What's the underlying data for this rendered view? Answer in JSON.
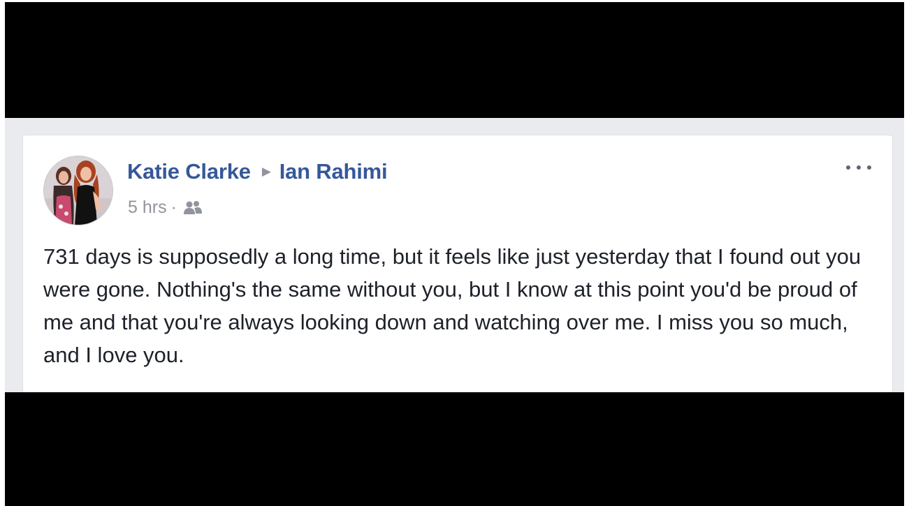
{
  "post": {
    "author": "Katie Clarke",
    "recipient": "Ian Rahimi",
    "timestamp": "5 hrs",
    "separator": "·",
    "audience_icon": "friends-icon",
    "avatar_icon": "profile-photo",
    "more_icon": "more-options-icon",
    "body": "731 days is supposedly a long time, but it feels like just yesterday that I found out you were gone. Nothing's the same without you, but I know at this point you'd be proud of me and that you're always looking down and watching over me. I miss you so much, and I love you."
  },
  "colors": {
    "name_link": "#365899",
    "meta_text": "#90949c",
    "body_text": "#1d2129",
    "feed_background": "#e9ebee",
    "letterbox": "#000000"
  }
}
